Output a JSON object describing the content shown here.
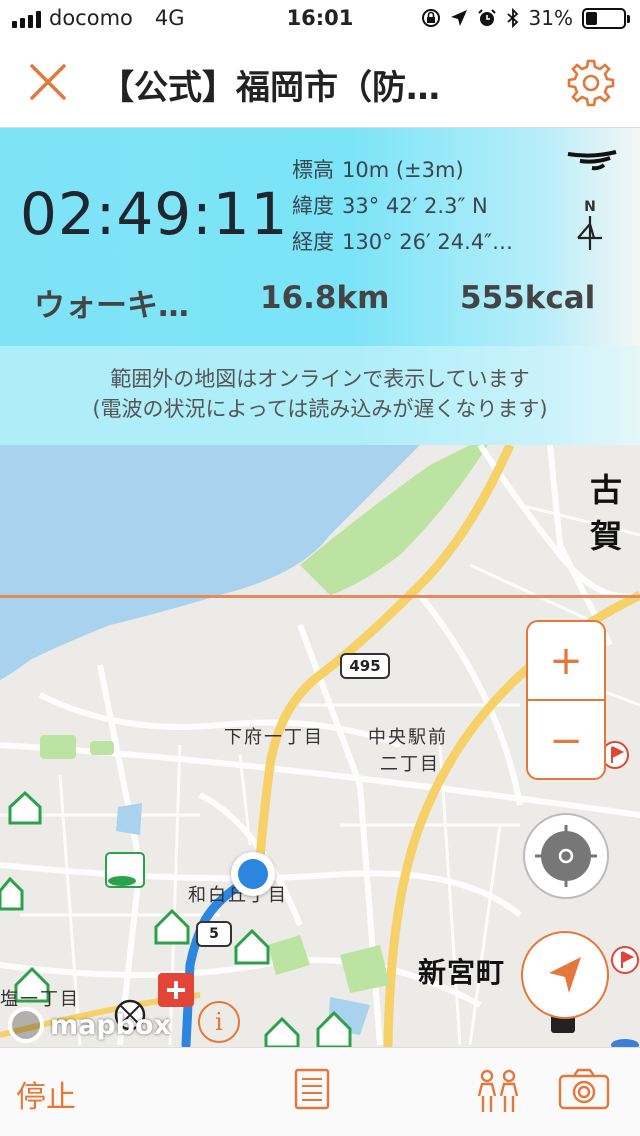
{
  "status_bar": {
    "carrier": "docomo",
    "network": "4G",
    "time": "16:01",
    "battery": "31%",
    "battery_level": 0.31
  },
  "nav": {
    "title": "【公式】福岡市（防…",
    "close_icon": "close-icon",
    "settings_icon": "gear-icon"
  },
  "info": {
    "elapsed": "02:49:11",
    "altitude_label": "標高",
    "altitude_value": "10m (±3m)",
    "latitude_label": "緯度",
    "latitude_value": "33° 42′ 2.3″ N",
    "longitude_label": "経度",
    "longitude_value": "130° 26′ 24.4″…",
    "north_label": "N",
    "activity": "ウォーキ…",
    "distance": "16.8km",
    "calories": "555kcal",
    "note_line1": "範囲外の地図はオンラインで表示しています",
    "note_line2": "(電波の状況によっては読み込みが遅くなります)"
  },
  "map": {
    "road_number": "495",
    "labels": {
      "shimofu": "下府一丁目",
      "chuoekimae": "中央駅前",
      "nichome": "二丁目",
      "wajiro": "和白丘丁目",
      "shingu": "新宮町",
      "ko": "古賀",
      "itchome": "塩一丁目",
      "road_small": "5"
    },
    "zoom_in": "+",
    "zoom_out": "−",
    "attribution": "mapbox",
    "info_button": "i",
    "accent_color": "#e4773a",
    "route_color": "#2c86e0"
  },
  "toolbar": {
    "stop_label": "停止",
    "list_icon": "list-icon",
    "people_icon": "people-icon",
    "camera_icon": "camera-icon"
  }
}
